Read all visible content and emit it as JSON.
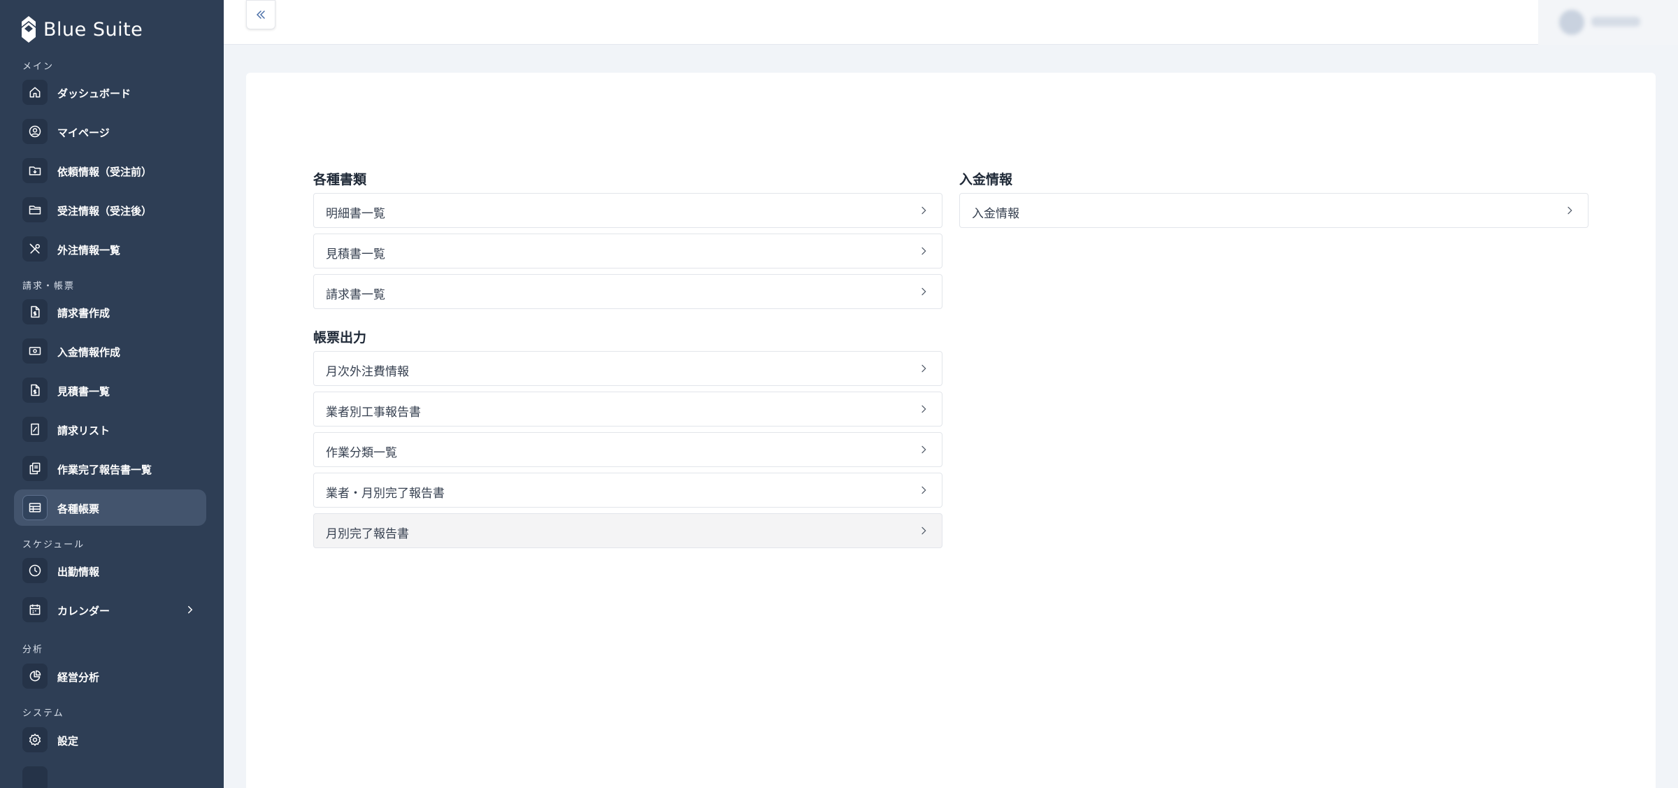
{
  "app": {
    "name": "Blue Suite"
  },
  "sidebar": {
    "sections": {
      "main": "メイン",
      "billing": "請求・帳票",
      "schedule": "スケジュール",
      "analysis": "分析",
      "system": "システム"
    },
    "items": {
      "dashboard": {
        "label": "ダッシュボード",
        "icon": "home-icon"
      },
      "mypage": {
        "label": "マイページ",
        "icon": "user-circle-icon"
      },
      "request_before": {
        "label": "依頼情報（受注前）",
        "icon": "folder-download-icon"
      },
      "order_after": {
        "label": "受注情報（受注後）",
        "icon": "folder-icon"
      },
      "outsourcing": {
        "label": "外注情報一覧",
        "icon": "tools-icon"
      },
      "invoice_create": {
        "label": "請求書作成",
        "icon": "file-dollar-icon"
      },
      "payment_create": {
        "label": "入金情報作成",
        "icon": "cash-icon"
      },
      "estimate_list": {
        "label": "見積書一覧",
        "icon": "file-dollar-icon"
      },
      "invoice_list": {
        "label": "請求リスト",
        "icon": "receipt-icon"
      },
      "completion_reports": {
        "label": "作業完了報告書一覧",
        "icon": "copy-icon"
      },
      "documents": {
        "label": "各種帳票",
        "icon": "table-icon",
        "active": true
      },
      "attendance": {
        "label": "出勤情報",
        "icon": "clock-icon"
      },
      "calendar": {
        "label": "カレンダー",
        "icon": "calendar-icon"
      },
      "business_analysis": {
        "label": "経営分析",
        "icon": "chart-pie-icon"
      },
      "settings": {
        "label": "設定",
        "icon": "gear-icon"
      }
    }
  },
  "main": {
    "groups": {
      "documents": {
        "title": "各種書類",
        "items": [
          "明細書一覧",
          "見積書一覧",
          "請求書一覧"
        ]
      },
      "output": {
        "title": "帳票出力",
        "items": [
          "月次外注費情報",
          "業者別工事報告書",
          "作業分類一覧",
          "業者・月別完了報告書",
          "月別完了報告書"
        ]
      },
      "payment": {
        "title": "入金情報",
        "items": [
          "入金情報"
        ]
      }
    }
  },
  "colors": {
    "sidebar_bg": "#2e3e55",
    "sidebar_active": "#43546d",
    "page_bg": "#f1f4f8",
    "card_bg": "#ffffff"
  }
}
